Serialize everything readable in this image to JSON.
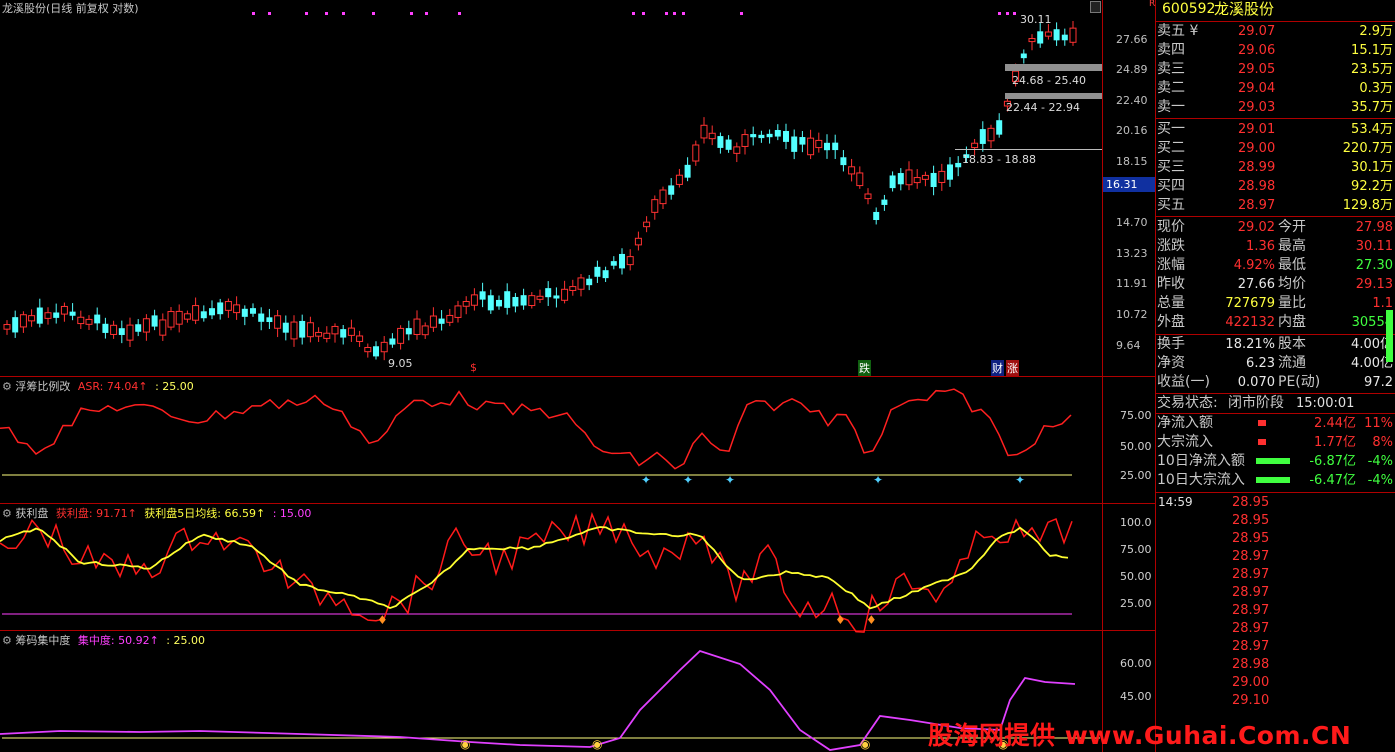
{
  "header": {
    "title": "龙溪股份(日线 前复权 对数)"
  },
  "main_chart": {
    "axis_ticks": [
      "27.66",
      "24.89",
      "22.40",
      "20.16",
      "18.15",
      "16.31",
      "14.70",
      "13.23",
      "11.91",
      "10.72",
      "9.64"
    ],
    "current_price_tag": "16.31",
    "annotations": {
      "high_label": "30.11",
      "low_label": "9.05",
      "band1": "24.68 - 25.40",
      "band2": "22.44 - 22.94",
      "band3": "18.83 - 18.88",
      "marker_s": "$",
      "marker_die": "跌",
      "marker_cai": "财",
      "marker_zhang": "涨"
    },
    "colors": {
      "up": "#ff3232",
      "down": "#54ffff",
      "axis": "#b00000"
    }
  },
  "panel1": {
    "name": "浮筹比例改",
    "label": "ASR: 74.04↑",
    "ref": ": 25.00",
    "ticks": [
      "75.00",
      "50.00",
      "25.00"
    ]
  },
  "panel2": {
    "name": "获利盘",
    "label1": "获利盘: 91.71↑",
    "label2": "获利盘5日均线: 66.59↑",
    "ref": ": 15.00",
    "ticks": [
      "100.0",
      "75.00",
      "50.00",
      "25.00"
    ]
  },
  "panel3": {
    "name": "筹码集中度",
    "label": "集中度: 50.92↑",
    "ref": ": 25.00",
    "ticks": [
      "60.00",
      "45.00"
    ]
  },
  "sidebar": {
    "code": "600592",
    "name": "龙溪股份",
    "r_badge": "R",
    "sell": [
      {
        "label": "卖五 ¥",
        "price": "29.07",
        "vol": "2.9万"
      },
      {
        "label": "卖四",
        "price": "29.06",
        "vol": "15.1万"
      },
      {
        "label": "卖三",
        "price": "29.05",
        "vol": "23.5万"
      },
      {
        "label": "卖二",
        "price": "29.04",
        "vol": "0.3万"
      },
      {
        "label": "卖一",
        "price": "29.03",
        "vol": "35.7万"
      }
    ],
    "buy": [
      {
        "label": "买一",
        "price": "29.01",
        "vol": "53.4万"
      },
      {
        "label": "买二",
        "price": "29.00",
        "vol": "220.7万"
      },
      {
        "label": "买三",
        "price": "28.99",
        "vol": "30.1万"
      },
      {
        "label": "买四",
        "price": "28.98",
        "vol": "92.2万"
      },
      {
        "label": "买五",
        "price": "28.97",
        "vol": "129.8万"
      }
    ],
    "quote": [
      {
        "l1": "现价",
        "v1": "29.02",
        "l2": "今开",
        "v2": "27.98"
      },
      {
        "l1": "涨跌",
        "v1": "1.36",
        "l2": "最高",
        "v2": "30.11"
      },
      {
        "l1": "涨幅",
        "v1": "4.92%",
        "l2": "最低",
        "v2": "27.30"
      },
      {
        "l1": "昨收",
        "v1": "27.66",
        "l2": "均价",
        "v2": "29.13"
      },
      {
        "l1": "总量",
        "v1": "727679",
        "l2": "量比",
        "v2": "1.1"
      },
      {
        "l1": "外盘",
        "v1": "422132",
        "l2": "内盘",
        "v2": "30554"
      }
    ],
    "fund": [
      {
        "l1": "换手",
        "v1": "18.21%",
        "l2": "股本",
        "v2": "4.00亿"
      },
      {
        "l1": "净资",
        "v1": "6.23",
        "l2": "流通",
        "v2": "4.00亿"
      },
      {
        "l1": "收益(一)",
        "v1": "0.070",
        "l2": "PE(动)",
        "v2": "97.2"
      }
    ],
    "trade_status_label": "交易状态:",
    "trade_status": "闭市阶段",
    "trade_time": "15:00:01",
    "flows": [
      {
        "label": "净流入额",
        "value": "2.44亿",
        "pct": "11%"
      },
      {
        "label": "大宗流入",
        "value": "1.77亿",
        "pct": "8%"
      },
      {
        "label": "10日净流入额",
        "value": "-6.87亿",
        "pct": "-4%"
      },
      {
        "label": "10日大宗流入",
        "value": "-6.47亿",
        "pct": "-4%"
      }
    ],
    "tick_time": "14:59",
    "ticks": [
      "28.95",
      "28.95",
      "28.95",
      "28.97",
      "28.97",
      "28.97",
      "28.97",
      "28.97",
      "28.97",
      "28.98",
      "29.00",
      "29.10"
    ]
  },
  "watermark": "股海网提供 www.Guhai.Com.CN"
}
